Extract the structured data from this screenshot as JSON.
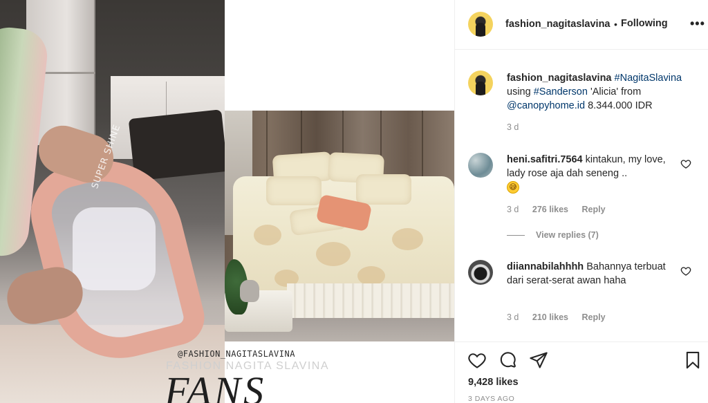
{
  "post": {
    "username": "fashion_nagitaslavina",
    "follow_separator": "•",
    "follow_status": "Following",
    "more_icon": "more-horizontal-icon",
    "likes": "9,428 likes",
    "date": "3 DAYS AGO"
  },
  "media": {
    "box_text": "SUPER SHINE",
    "watermark_handle": "@FASHION_NAGITASLAVINA",
    "watermark_name": "FASHION NAGITA SLAVINA",
    "watermark_big": "FANS"
  },
  "caption": {
    "username": "fashion_nagitaslavina",
    "hashtag1": "#NagitaSlavina",
    "text1": "using",
    "hashtag2": "#Sanderson",
    "text2": "'Alicia' from",
    "mention": "@canopyhome.id",
    "text3": "8.344.000 IDR",
    "time": "3 d"
  },
  "comments": [
    {
      "username": "heni.safitri.7564",
      "text": "kintakun, my love, lady rose aja dah seneng ..",
      "emoji": "grinning-sweat-emoji",
      "time": "3 d",
      "likes": "276 likes",
      "reply": "Reply",
      "view_replies": "View replies (7)"
    },
    {
      "username": "diiannabilahhhh",
      "text": "Bahannya terbuat dari serat-serat awan haha",
      "time": "3 d",
      "likes": "210 likes",
      "reply": "Reply"
    }
  ],
  "actions": {
    "like_icon": "heart-icon",
    "comment_icon": "comment-icon",
    "share_icon": "send-icon",
    "save_icon": "bookmark-icon"
  },
  "colors": {
    "text": "#262626",
    "muted": "#8e8e8e",
    "link": "#00376b",
    "border": "#efefef"
  }
}
